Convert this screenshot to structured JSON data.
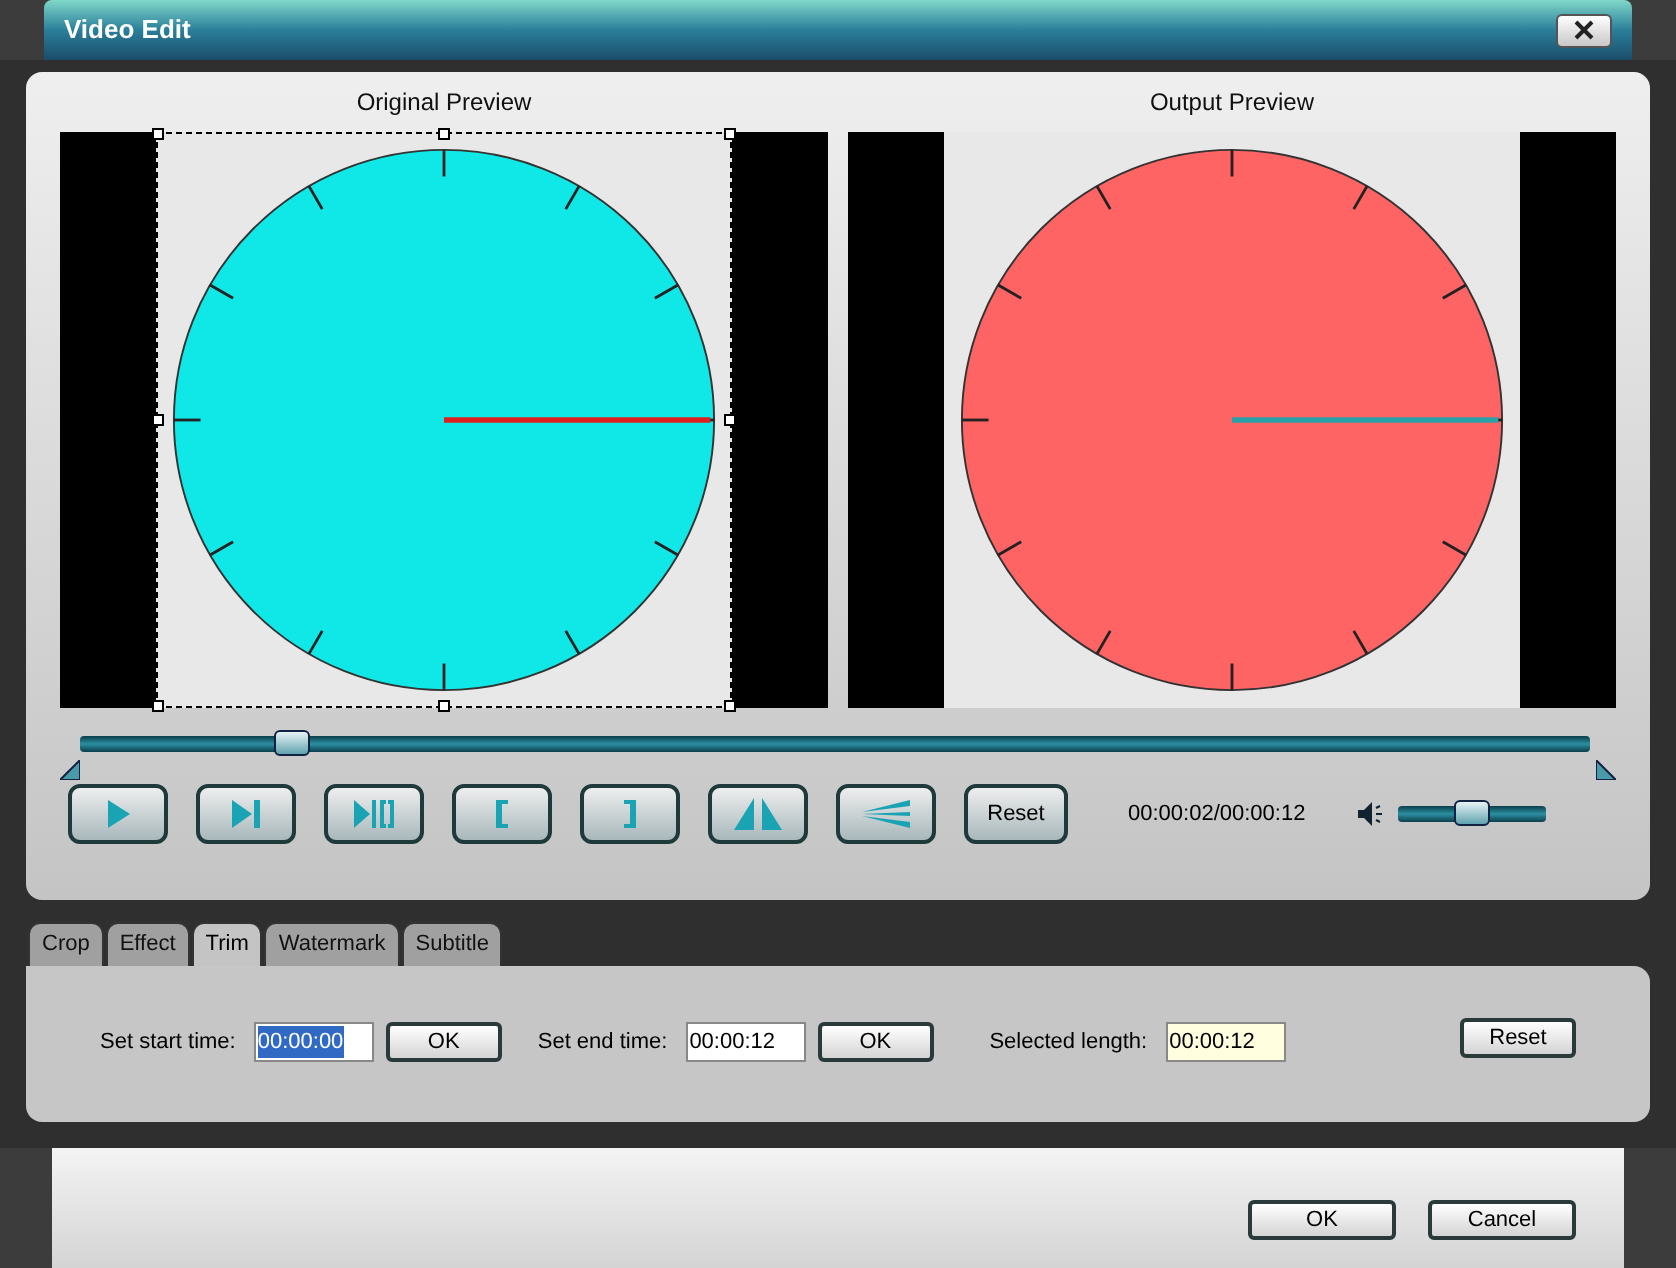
{
  "window": {
    "title": "Video Edit"
  },
  "previews": [
    {
      "title": "Original Preview",
      "kind": "original",
      "crop_frame": true
    },
    {
      "title": "Output Preview",
      "kind": "output",
      "crop_frame": false
    }
  ],
  "seek": {
    "level": 0.14
  },
  "controls": [
    {
      "kind": "play"
    },
    {
      "kind": "next"
    },
    {
      "kind": "split"
    },
    {
      "kind": "mark-in"
    },
    {
      "kind": "mark-out"
    },
    {
      "kind": "flip"
    },
    {
      "kind": "lines"
    },
    {
      "kind": "text",
      "label": "Reset"
    }
  ],
  "time": "00:00:02/00:00:12",
  "volume": {
    "level": 0.5
  },
  "tabs": [
    {
      "label": "Crop",
      "selected": false
    },
    {
      "label": "Effect",
      "selected": false
    },
    {
      "label": "Trim",
      "selected": true
    },
    {
      "label": "Watermark",
      "selected": false
    },
    {
      "label": "Subtitle",
      "selected": false
    }
  ],
  "trim": [
    {
      "label": "Set start time:",
      "value": "00:00:00",
      "kind": "edit",
      "highlighted": true,
      "button": "OK"
    },
    {
      "label": "Set end time:",
      "value": "00:00:12",
      "kind": "edit",
      "highlighted": false,
      "button": "OK"
    },
    {
      "label": "Selected length:",
      "value": "00:00:12",
      "kind": "readonly",
      "highlighted": false
    }
  ],
  "trim_reset": "Reset",
  "buttons": [
    "OK",
    "Cancel"
  ]
}
